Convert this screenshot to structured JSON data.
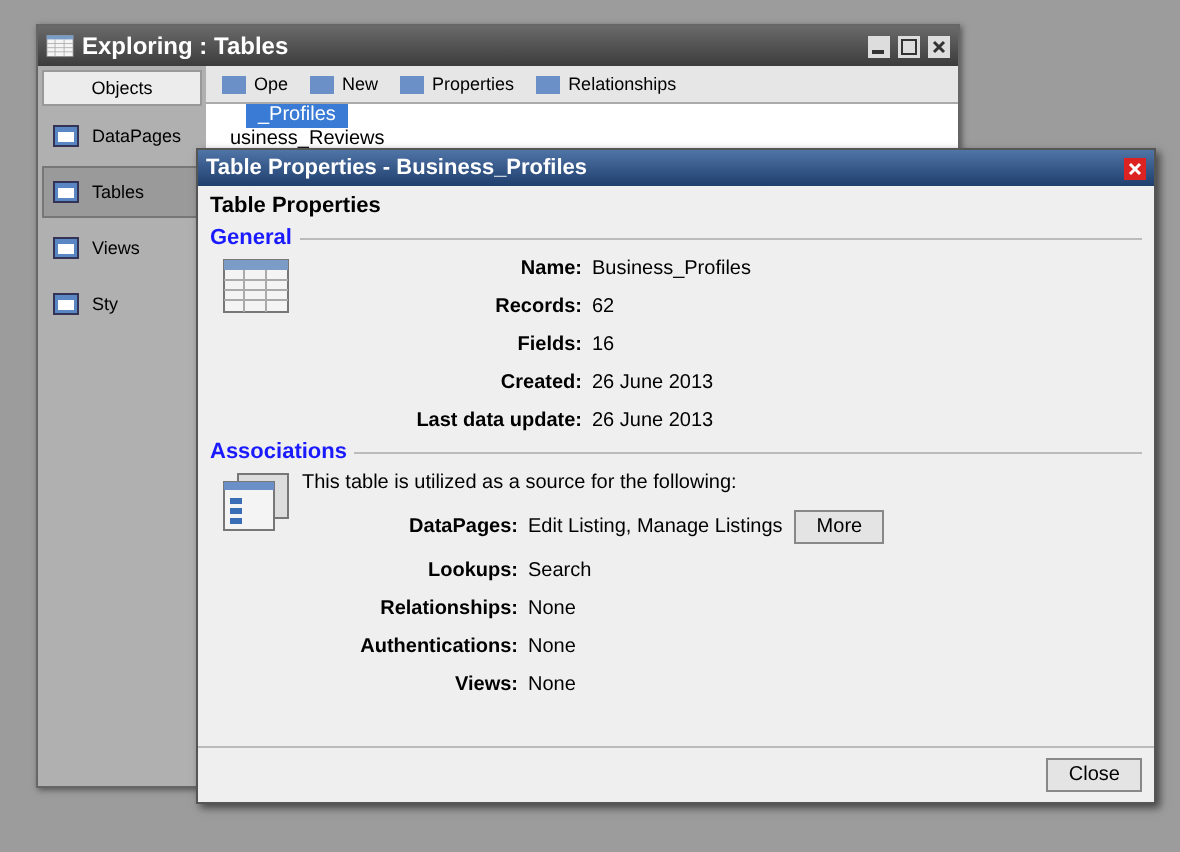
{
  "back_window": {
    "title": "Exploring : Tables",
    "objects_header": "Objects",
    "objects": [
      {
        "label": "DataPages",
        "selected": false
      },
      {
        "label": "Tables",
        "selected": true
      },
      {
        "label": "Views",
        "selected": false
      },
      {
        "label": "Sty",
        "selected": false
      }
    ],
    "toolbar": [
      "Ope",
      "New",
      "Properties",
      "Relationships"
    ],
    "tables": [
      {
        "name": "_Profiles",
        "selected": true
      },
      {
        "name": "usiness_Reviews",
        "selected": false
      }
    ]
  },
  "dialog": {
    "title": "Table Properties - Business_Profiles",
    "heading": "Table Properties",
    "general": {
      "title": "General",
      "fields": [
        {
          "label": "Name:",
          "value": "Business_Profiles"
        },
        {
          "label": "Records:",
          "value": "62"
        },
        {
          "label": "Fields:",
          "value": "16"
        },
        {
          "label": "Created:",
          "value": "26 June 2013"
        },
        {
          "label": "Last data update:",
          "value": "26 June 2013"
        }
      ]
    },
    "associations": {
      "title": "Associations",
      "intro": "This table is utilized as a source for the following:",
      "fields": [
        {
          "label": "DataPages:",
          "value": "Edit Listing, Manage Listings",
          "button": "More"
        },
        {
          "label": "Lookups:",
          "value": "Search"
        },
        {
          "label": "Relationships:",
          "value": "None"
        },
        {
          "label": "Authentications:",
          "value": "None"
        },
        {
          "label": "Views:",
          "value": "None"
        }
      ]
    },
    "close_button": "Close"
  }
}
